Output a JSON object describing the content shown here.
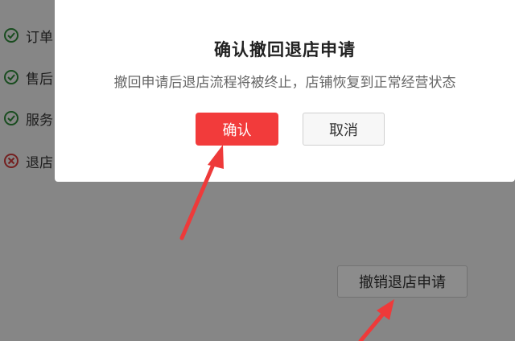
{
  "status_list": {
    "items": [
      {
        "label": "订单",
        "state": "done"
      },
      {
        "label": "售后",
        "state": "done"
      },
      {
        "label": "服务",
        "state": "done"
      },
      {
        "label": "退店",
        "state": "failed"
      }
    ]
  },
  "dialog": {
    "title": "确认撤回退店申请",
    "description": "撤回申请后退店流程将被终止，店铺恢复到正常经营状态",
    "confirm_label": "确认",
    "cancel_label": "取消"
  },
  "page": {
    "withdraw_button_label": "撤销退店申请"
  },
  "colors": {
    "accent_red": "#f23b3b",
    "check_green": "#2e8b3a",
    "fail_red": "#d33b3b",
    "annotation_arrow": "#ee3a3a"
  }
}
